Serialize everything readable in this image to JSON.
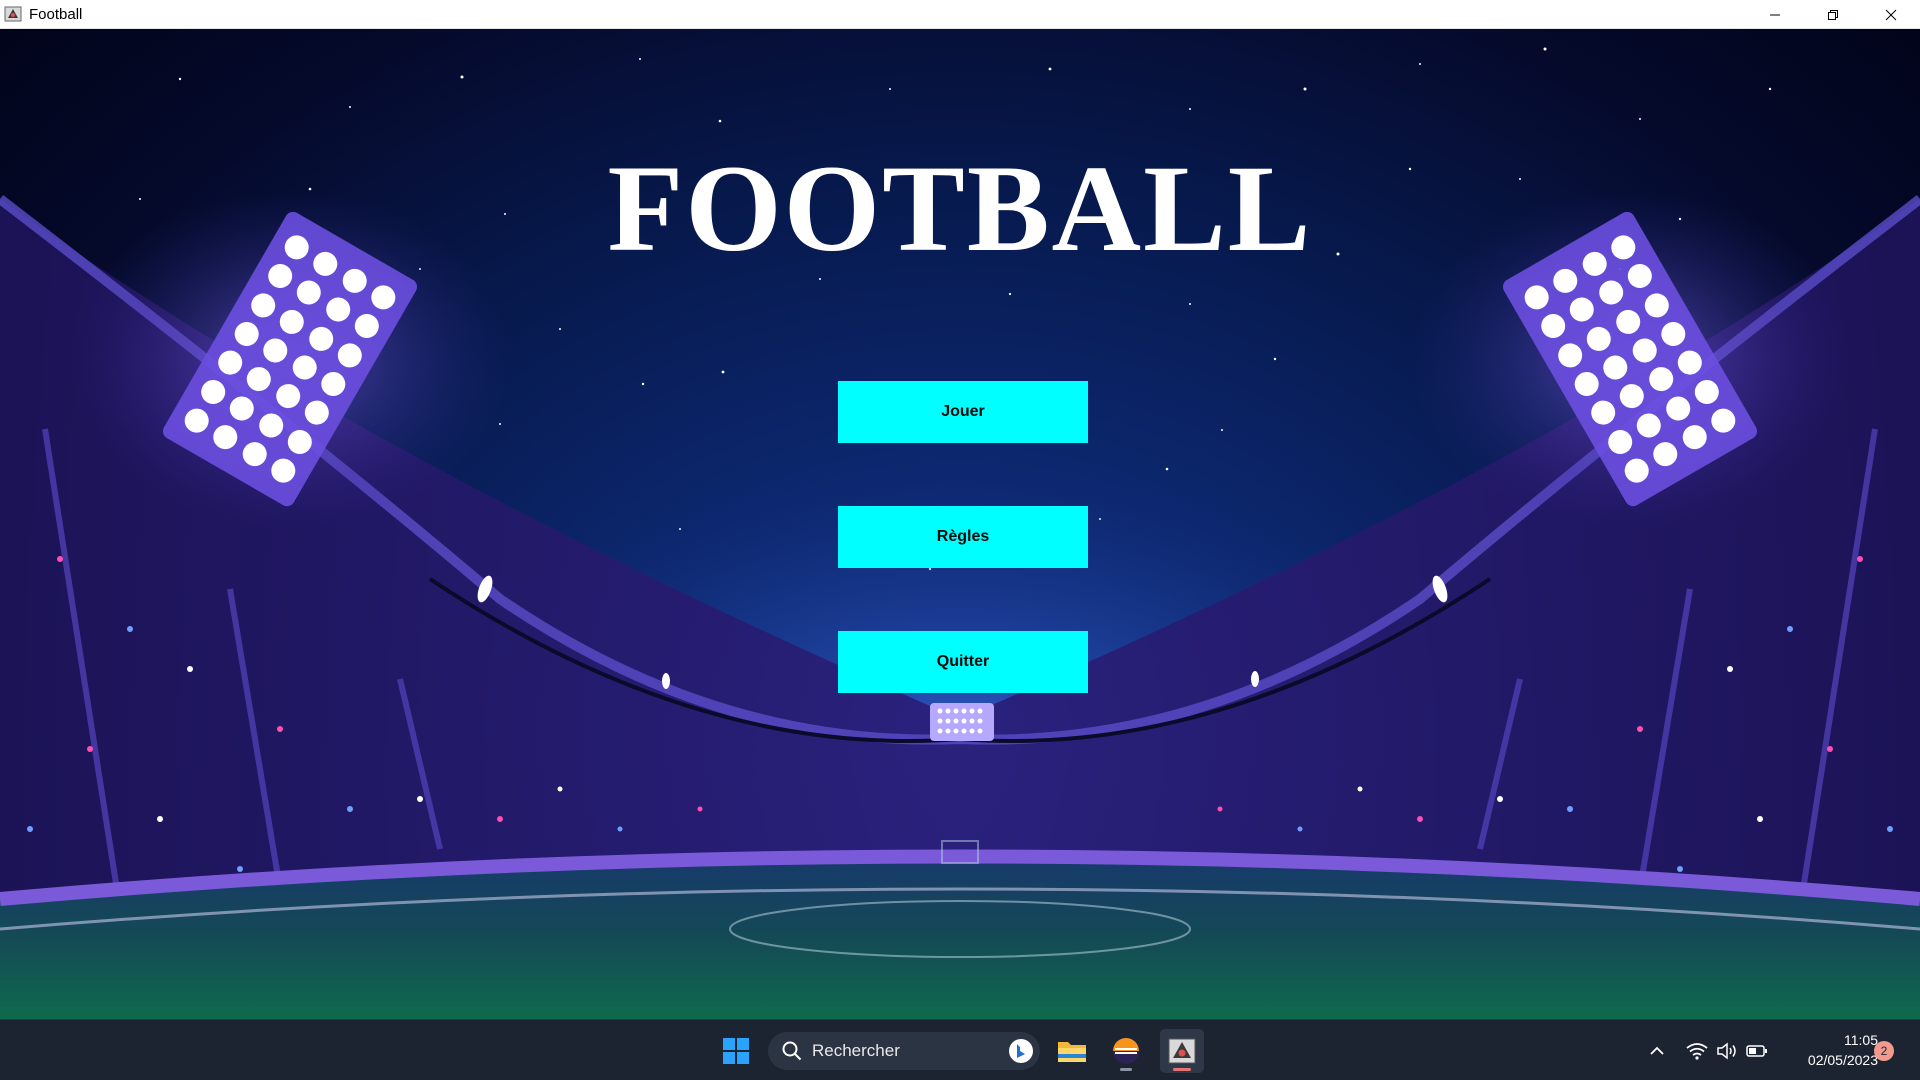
{
  "window": {
    "title": "Football",
    "app_icon": "football-app-icon",
    "controls": [
      "minimize-icon",
      "restore-icon",
      "close-icon"
    ]
  },
  "game": {
    "title": "FOOTBALL",
    "menu": {
      "play_label": "Jouer",
      "rules_label": "Règles",
      "quit_label": "Quitter"
    },
    "colors": {
      "button_bg": "#00ffff",
      "title_color": "#ffffff",
      "sky_dark": "#02041a",
      "sky_light": "#1a3fa0"
    }
  },
  "taskbar": {
    "start_icon": "windows-start-icon",
    "search": {
      "placeholder": "Rechercher",
      "icon": "search-icon",
      "bing_icon": "bing-icon"
    },
    "apps": [
      {
        "name": "file-explorer-icon"
      },
      {
        "name": "eclipse-icon"
      },
      {
        "name": "football-app-icon"
      }
    ],
    "tray": {
      "icons": [
        "chevron-up-icon",
        "wifi-icon",
        "volume-icon",
        "battery-icon"
      ]
    },
    "clock": {
      "time": "11:05",
      "date": "02/05/2023"
    },
    "notifications": {
      "count": "2"
    }
  }
}
